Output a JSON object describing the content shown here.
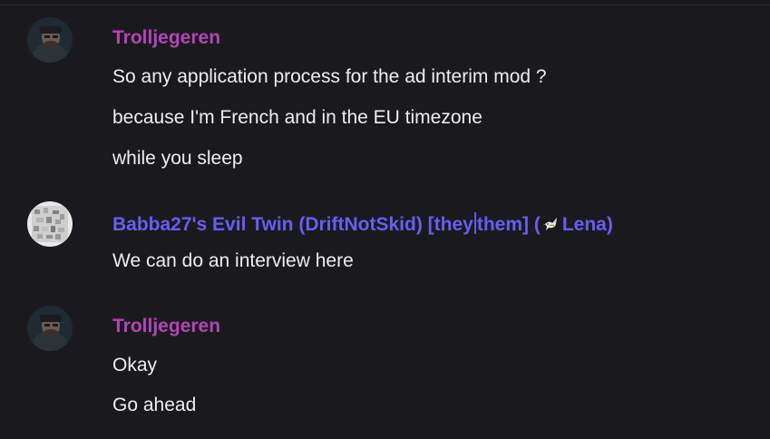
{
  "colors": {
    "background": "#1a1a1e",
    "text": "#eceef1",
    "user_troll": "#b444b5",
    "user_babba": "#6a5cf2"
  },
  "messages": [
    {
      "username": "Trolljegeren",
      "avatar": "dark-portrait-avatar",
      "lines": [
        "So any application process for the ad interim mod ?",
        "because I'm French and in the EU timezone",
        "while you sleep"
      ]
    },
    {
      "username_parts": {
        "prefix": "Babba27's Evil Twin (DriftNotSkid) [they",
        "middle": "them] (",
        "icon": "dove-icon",
        "suffix": "Lena)"
      },
      "avatar": "noise-pattern-avatar",
      "lines": [
        "We can do an interview here"
      ]
    },
    {
      "username": "Trolljegeren",
      "avatar": "dark-portrait-avatar",
      "lines": [
        "Okay",
        "Go ahead"
      ]
    }
  ]
}
